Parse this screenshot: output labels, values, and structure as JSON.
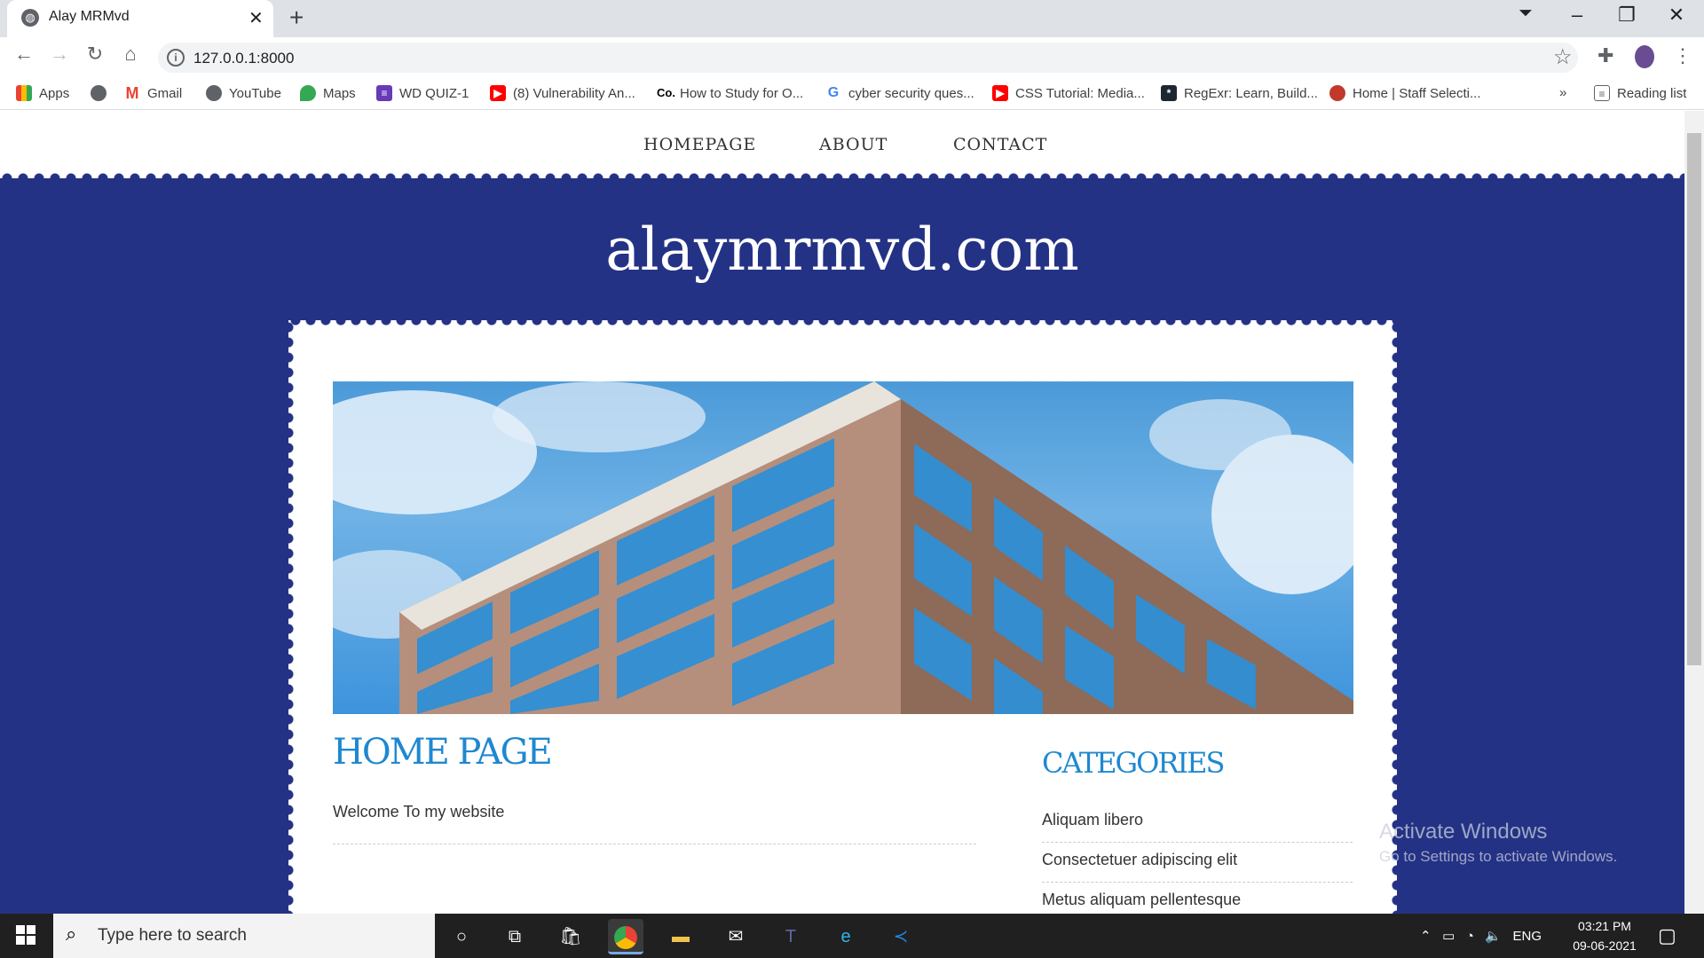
{
  "browser": {
    "tab_title": "Alay MRMvd",
    "url": "127.0.0.1:8000",
    "bookmarks": [
      "Apps",
      "",
      "Gmail",
      "YouTube",
      "Maps",
      "WD QUIZ-1",
      "(8) Vulnerability An...",
      "How to Study for O...",
      "cyber security ques...",
      "CSS Tutorial: Media...",
      "RegExr: Learn, Build...",
      "Home | Staff Selecti..."
    ],
    "more": "»",
    "reading_list": "Reading list"
  },
  "site": {
    "nav": [
      "HOMEPAGE",
      "ABOUT",
      "CONTACT"
    ],
    "title": "alaymrmvd.com",
    "heading": "HOME PAGE",
    "welcome": "Welcome To my website",
    "categories_heading": "CATEGORIES",
    "categories": [
      "Aliquam libero",
      "Consectetuer adipiscing elit",
      "Metus aliquam pellentesque"
    ]
  },
  "watermark": {
    "title": "Activate Windows",
    "sub": "Go to Settings to activate Windows."
  },
  "taskbar": {
    "search_placeholder": "Type here to search",
    "lang": "ENG",
    "time": "03:21 PM",
    "date": "09-06-2021"
  },
  "colors": {
    "page_blue": "#243285",
    "heading_blue": "#1e88d0"
  }
}
